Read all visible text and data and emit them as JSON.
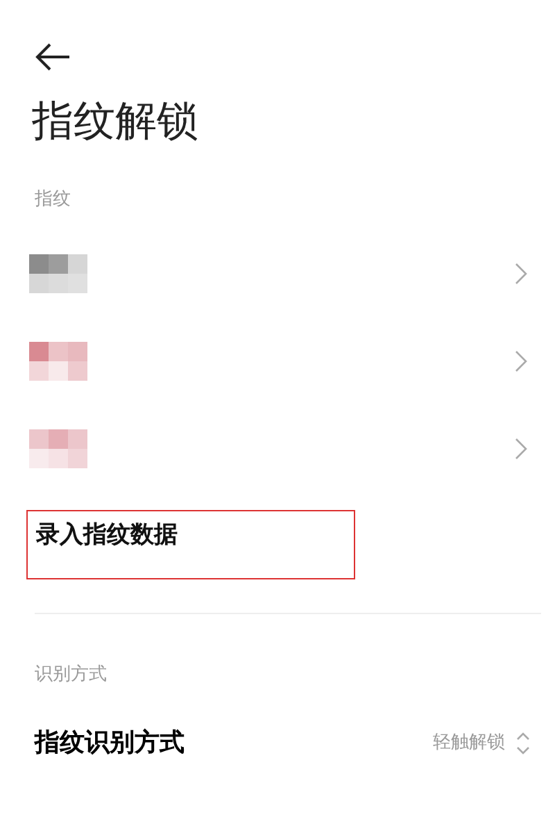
{
  "title": "指纹解锁",
  "fingerprint_section": {
    "header": "指纹",
    "items": [
      {
        "kind": "masked",
        "color": "#8c8c8c"
      },
      {
        "kind": "masked",
        "color": "#d98a92"
      },
      {
        "kind": "masked",
        "color": "#e0a0a8"
      }
    ],
    "add_button": {
      "label": "录入指纹数据",
      "highlighted": true
    }
  },
  "recognition_section": {
    "header": "识别方式",
    "rows": [
      {
        "label": "指纹识别方式",
        "value": "轻触解锁"
      }
    ]
  }
}
